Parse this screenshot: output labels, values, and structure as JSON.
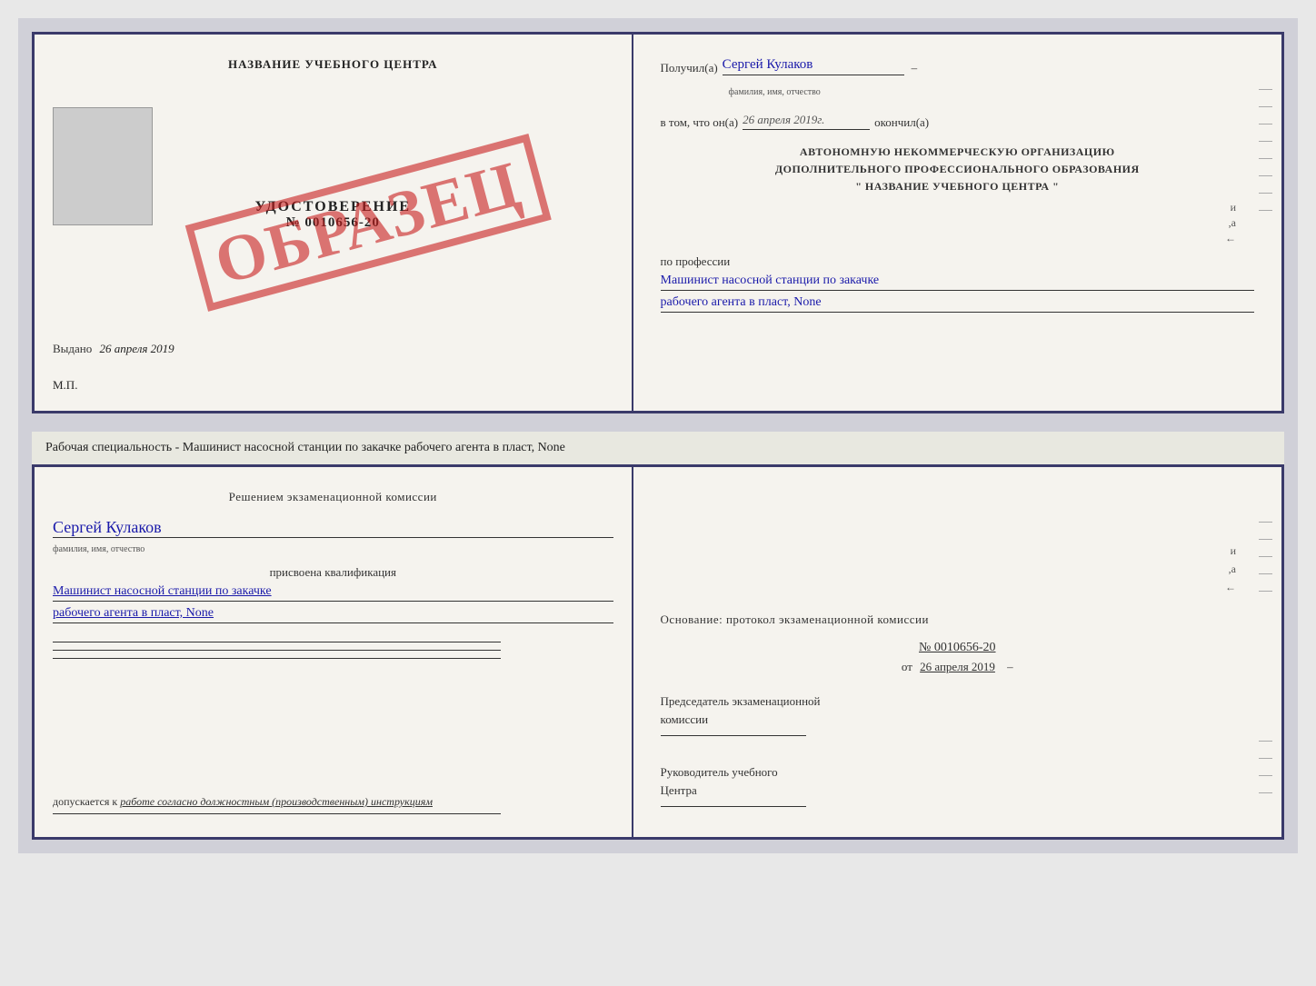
{
  "top_doc": {
    "left": {
      "title": "НАЗВАНИЕ УЧЕБНОГО ЦЕНТРА",
      "udostoverenie": "УДОСТОВЕРЕНИЕ",
      "nomer": "№ 0010656-20",
      "stamp": "ОБРАЗЕЦ",
      "vydano_label": "Выдано",
      "vydano_date": "26 апреля 2019",
      "mp": "М.П."
    },
    "right": {
      "poluchil_label": "Получил(а)",
      "poluchil_name": "Сергей Кулаков",
      "fio_sublabel": "фамилия, имя, отчество",
      "vtom_label": "в том, что он(а)",
      "vtom_date": "26 апреля 2019г.",
      "okonchil_label": "окончил(а)",
      "org_line1": "АВТОНОМНУЮ НЕКОММЕРЧЕСКУЮ ОРГАНИЗАЦИЮ",
      "org_line2": "ДОПОЛНИТЕЛЬНОГО ПРОФЕССИОНАЛЬНОГО ОБРАЗОВАНИЯ",
      "org_line3": "\"   НАЗВАНИЕ УЧЕБНОГО ЦЕНТРА   \"",
      "po_professii": "по профессии",
      "profession_line1": "Машинист насосной станции по закачке",
      "profession_line2": "рабочего агента в пласт, None"
    }
  },
  "below_text": "Рабочая специальность - Машинист насосной станции по закачке рабочего агента в пласт, None",
  "bottom_doc": {
    "left": {
      "title": "Решением экзаменационной комиссии",
      "name": "Сергей Кулаков",
      "fio_sublabel": "фамилия, имя, отчество",
      "prisvoena": "присвоена квалификация",
      "kvalif_line1": "Машинист насосной станции по закачке",
      "kvalif_line2": "рабочего агента в пласт, None",
      "dopuskaetsya_label": "допускается к",
      "dopuskaetsya_text": "работе согласно должностным (производственным) инструкциям"
    },
    "right": {
      "osnovanie_label": "Основание: протокол экзаменационной комиссии",
      "nomer": "№ 0010656-20",
      "ot_label": "от",
      "ot_date": "26 апреля 2019",
      "predsedatel_label": "Председатель экзаменационной",
      "predsedatel_label2": "комиссии",
      "rukovoditel_label": "Руководитель учебного",
      "rukovoditel_label2": "Центра"
    }
  }
}
